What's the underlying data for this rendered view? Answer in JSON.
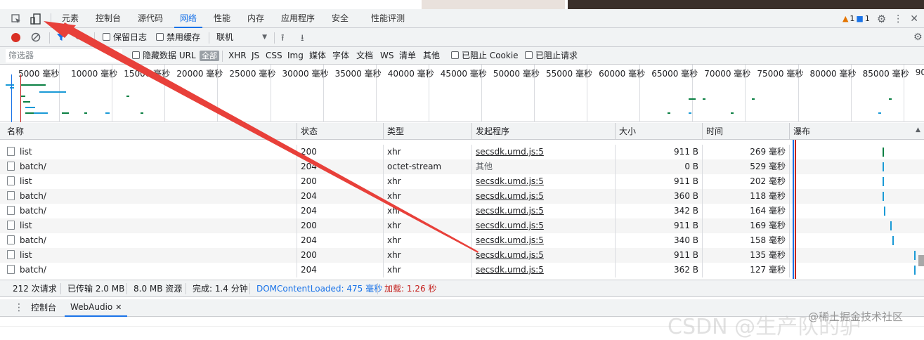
{
  "tabs": [
    "元素",
    "控制台",
    "源代码",
    "网络",
    "性能",
    "内存",
    "应用程序",
    "安全",
    "性能评测"
  ],
  "active_tab": "网络",
  "issues": {
    "warnings": "1",
    "messages": "1"
  },
  "toolbar": {
    "preserve_log": "保留日志",
    "disable_cache": "禁用缓存",
    "throttling": "联机"
  },
  "filter": {
    "placeholder": "筛选器",
    "hide_data_url": "隐藏数据 URL",
    "types": [
      "全部",
      "XHR",
      "JS",
      "CSS",
      "Img",
      "媒体",
      "字体",
      "文档",
      "WS",
      "清单",
      "其他"
    ],
    "blocked_cookies": "已阻止 Cookie",
    "blocked_requests": "已阻止请求"
  },
  "overview_ticks": [
    "5000 毫秒",
    "10000 毫秒",
    "15000 毫秒",
    "20000 毫秒",
    "25000 毫秒",
    "30000 毫秒",
    "35000 毫秒",
    "40000 毫秒",
    "45000 毫秒",
    "50000 毫秒",
    "55000 毫秒",
    "60000 毫秒",
    "65000 毫秒",
    "70000 毫秒",
    "75000 毫秒",
    "80000 毫秒",
    "85000 毫秒",
    "900"
  ],
  "columns": [
    "名称",
    "状态",
    "类型",
    "发起程序",
    "大小",
    "时间",
    "瀑布"
  ],
  "rows": [
    {
      "name": "list",
      "status": "200",
      "type": "xhr",
      "initiator": "secsdk.umd.js:5",
      "size": "911 B",
      "time": "269 毫秒",
      "wf_offset": 0.72
    },
    {
      "name": "batch/",
      "status": "204",
      "type": "octet-stream",
      "initiator": "其他",
      "size": "0 B",
      "time": "529 毫秒",
      "wf_offset": 0.72
    },
    {
      "name": "list",
      "status": "200",
      "type": "xhr",
      "initiator": "secsdk.umd.js:5",
      "size": "911 B",
      "time": "202 毫秒",
      "wf_offset": 0.72
    },
    {
      "name": "batch/",
      "status": "204",
      "type": "xhr",
      "initiator": "secsdk.umd.js:5",
      "size": "360 B",
      "time": "118 毫秒",
      "wf_offset": 0.72
    },
    {
      "name": "batch/",
      "status": "204",
      "type": "xhr",
      "initiator": "secsdk.umd.js:5",
      "size": "342 B",
      "time": "164 毫秒",
      "wf_offset": 0.73
    },
    {
      "name": "list",
      "status": "200",
      "type": "xhr",
      "initiator": "secsdk.umd.js:5",
      "size": "911 B",
      "time": "169 毫秒",
      "wf_offset": 0.78
    },
    {
      "name": "batch/",
      "status": "204",
      "type": "xhr",
      "initiator": "secsdk.umd.js:5",
      "size": "340 B",
      "time": "158 毫秒",
      "wf_offset": 0.8
    },
    {
      "name": "list",
      "status": "200",
      "type": "xhr",
      "initiator": "secsdk.umd.js:5",
      "size": "911 B",
      "time": "135 毫秒",
      "wf_offset": 0.98
    },
    {
      "name": "batch/",
      "status": "204",
      "type": "xhr",
      "initiator": "secsdk.umd.js:5",
      "size": "362 B",
      "time": "127 毫秒",
      "wf_offset": 0.98
    }
  ],
  "status": {
    "requests": "212 次请求",
    "transferred": "已传输 2.0 MB",
    "resources": "8.0 MB 资源",
    "finish": "完成: 1.4 分钟",
    "dcl": "DOMContentLoaded: 475 毫秒",
    "load": "加载: 1.26 秒"
  },
  "drawer_tabs": [
    "控制台",
    "WebAudio"
  ],
  "watermarks": [
    "CSDN @生产队的驴",
    "@稀土掘金技术社区"
  ],
  "colors": {
    "accent": "#1a73e8",
    "record": "#d93025",
    "arrow": "#e8403a",
    "dcl": "#1a73e8",
    "load": "#c5221f",
    "waterfall": "#1a9ad6"
  }
}
